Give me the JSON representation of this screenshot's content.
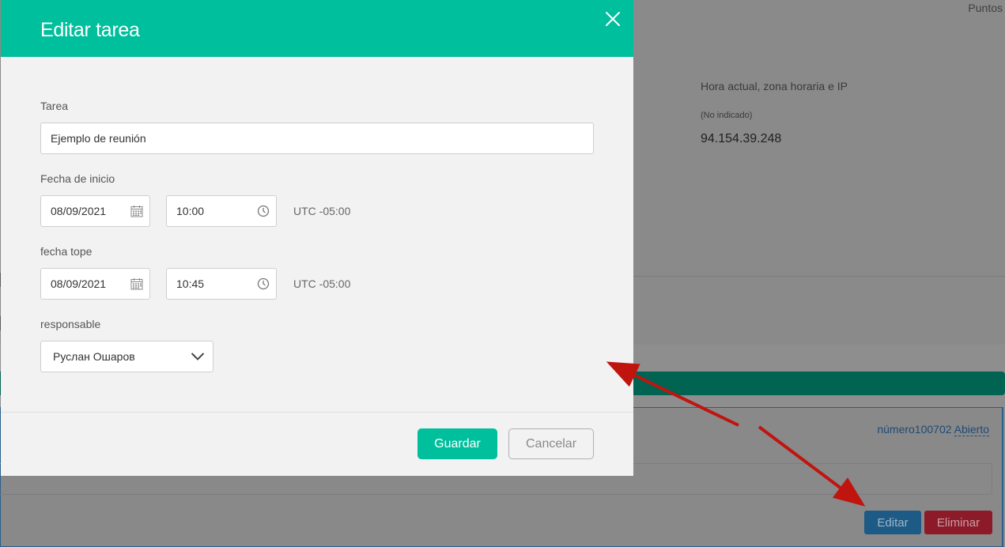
{
  "background": {
    "puntos_label": "Puntos",
    "info_label": "Hora actual, zona horaria e IP",
    "info_timezone": "(No indicado)",
    "info_ip": "94.154.39.248",
    "card": {
      "numero_label": "número100702",
      "status_link": "Abierto",
      "edit_button": "Editar",
      "delete_button": "Eliminar"
    }
  },
  "modal": {
    "title": "Editar tarea",
    "task": {
      "label": "Tarea",
      "value": "Ejemplo de reunión"
    },
    "start": {
      "label": "Fecha de inicio",
      "date": "08/09/2021",
      "time": "10:00",
      "timezone": "UTC -05:00"
    },
    "deadline": {
      "label": "fecha tope",
      "date": "08/09/2021",
      "time": "10:45",
      "timezone": "UTC -05:00"
    },
    "responsible": {
      "label": "responsable",
      "value": "Руслан Ошаров"
    },
    "save_button": "Guardar",
    "cancel_button": "Cancelar"
  },
  "colors": {
    "accent": "#00bf9c",
    "annotation_arrow": "#c0140f"
  },
  "icons": [
    "close-icon",
    "calendar-icon",
    "clock-icon",
    "chevron-down-icon",
    "annotation-arrow"
  ]
}
